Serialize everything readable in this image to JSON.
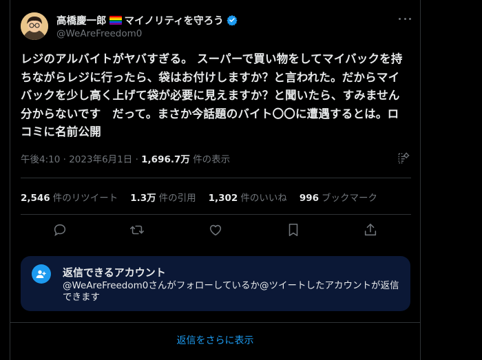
{
  "author": {
    "name": "高橋慶一郎",
    "name_suffix": "マイノリティを守ろう",
    "handle": "@WeAreFreedom0",
    "verified_color": "#1d9bf0"
  },
  "tweet": {
    "lines": [
      "レジのアルバイトがヤバすぎる。 スーパーで買い物をしてマイバックを持",
      "ちながらレジに行ったら、袋はお付けしますか？と言われた。だからマイ",
      "バックを少し高く上げて袋が必要に見えますか？と聞いたら、すみません",
      "分からないです　だって。まさか今話題のバイト〇〇に遭遇するとは。ロ",
      "コミに名前公開"
    ]
  },
  "meta": {
    "time": "午後4:10",
    "date": "2023年6月1日",
    "views_value": "1,696.7万",
    "views_label": "件の表示"
  },
  "stats": [
    {
      "value": "2,546",
      "label": "件のリツイート"
    },
    {
      "value": "1.3万",
      "label": "件の引用"
    },
    {
      "value": "1,302",
      "label": "件のいいね"
    },
    {
      "value": "996",
      "label": "ブックマーク"
    }
  ],
  "actions": [
    "reply-icon",
    "retweet-icon",
    "like-icon",
    "bookmark-icon",
    "share-icon"
  ],
  "reply_restriction": {
    "title": "返信できるアカウント",
    "description": "@WeAreFreedom0さんがフォローしているか@ツイートしたアカウントが返信できます"
  },
  "show_more_label": "返信をさらに表示",
  "colors": {
    "background": "#000000",
    "text": "#e7e9ea",
    "muted": "#71767b",
    "accent": "#1d9bf0",
    "reply_box": "#0b1836"
  }
}
